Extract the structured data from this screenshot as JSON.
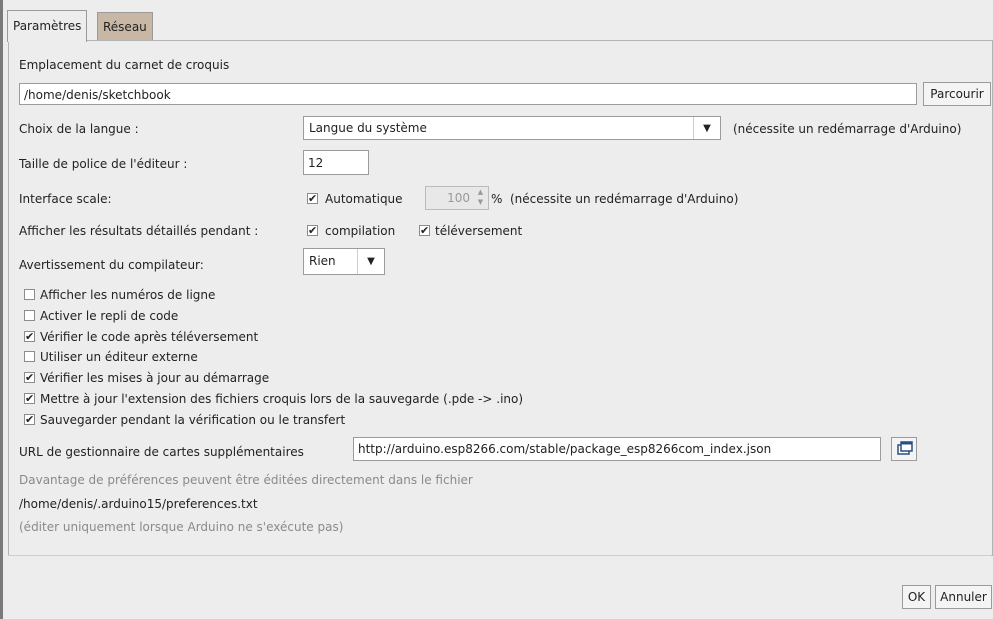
{
  "tabs": [
    {
      "label": "Paramètres"
    },
    {
      "label": "Réseau"
    }
  ],
  "sketchbook": {
    "label": "Emplacement du carnet de croquis",
    "path": "/home/denis/sketchbook",
    "browse_label": "Parcourir"
  },
  "language": {
    "label": "Choix de la langue :",
    "value": "Langue du système",
    "note": "(nécessite un redémarrage d'Arduino)"
  },
  "font_size": {
    "label": "Taille de police de l'éditeur :",
    "value": "12"
  },
  "interface_scale": {
    "label": "Interface scale:",
    "auto_label": "Automatique",
    "auto_checked": true,
    "value": "100",
    "unit": "%",
    "note": "(nécessite un redémarrage d'Arduino)"
  },
  "verbose": {
    "label": "Afficher les résultats détaillés pendant :",
    "compile_label": "compilation",
    "compile_checked": true,
    "upload_label": "téléversement",
    "upload_checked": true
  },
  "warnings": {
    "label": "Avertissement du compilateur:",
    "value": "Rien"
  },
  "options": [
    {
      "label": "Afficher les numéros de ligne",
      "checked": false
    },
    {
      "label": "Activer le repli de code",
      "checked": false
    },
    {
      "label": "Vérifier le code après téléversement",
      "checked": true
    },
    {
      "label": "Utiliser un éditeur externe",
      "checked": false
    },
    {
      "label": "Vérifier les mises à jour au démarrage",
      "checked": true
    },
    {
      "label": "Mettre à jour  l'extension des fichiers croquis lors de la sauvegarde (.pde -> .ino)",
      "checked": true
    },
    {
      "label": "Sauvegarder pendant la vérification ou le transfert",
      "checked": true
    }
  ],
  "boards_url": {
    "label": "URL de gestionnaire de cartes supplémentaires",
    "value": "http://arduino.esp8266.com/stable/package_esp8266com_index.json"
  },
  "footer": {
    "more_prefs": "Davantage de préférences peuvent être éditées directement dans le fichier",
    "prefs_path": "/home/denis/.arduino15/preferences.txt",
    "edit_note": "(éditer uniquement lorsque Arduino ne s'exécute pas)"
  },
  "buttons": {
    "ok": "OK",
    "cancel": "Annuler"
  },
  "check_mark": "✔"
}
